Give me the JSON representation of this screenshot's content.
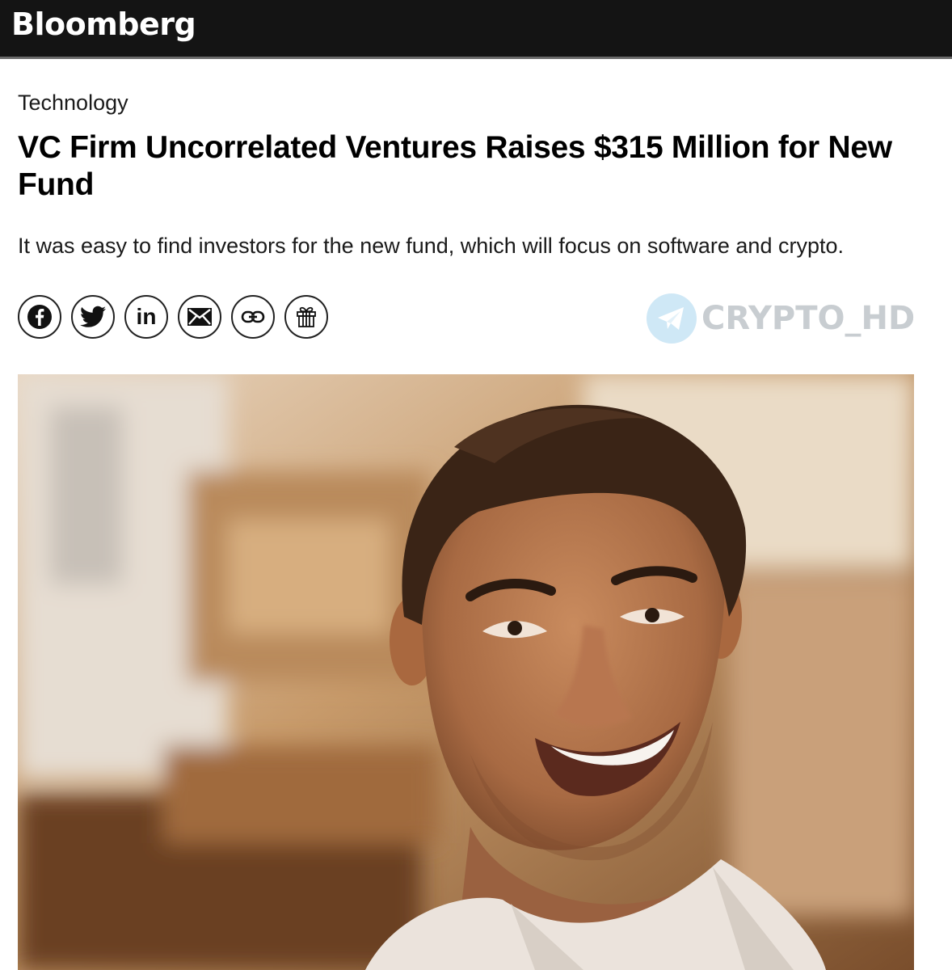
{
  "header": {
    "brand": "Bloomberg"
  },
  "article": {
    "category": "Technology",
    "headline": "VC Firm Uncorrelated Ventures Raises $315 Million for New Fund",
    "dek": "It was easy to find investors for the new fund, which will focus on software and crypto."
  },
  "share": {
    "icons": [
      "facebook-icon",
      "twitter-icon",
      "linkedin-icon",
      "email-icon",
      "link-icon",
      "gift-icon"
    ],
    "linkedin_text": "in"
  },
  "watermark": {
    "text": "CRYPTO_HD",
    "icon": "telegram-icon"
  },
  "colors": {
    "topbar": "#141414",
    "topbar_border": "#6a6a6a",
    "watermark_text": "#c8cdd1",
    "watermark_icon_bg": "#cfe8f6"
  }
}
